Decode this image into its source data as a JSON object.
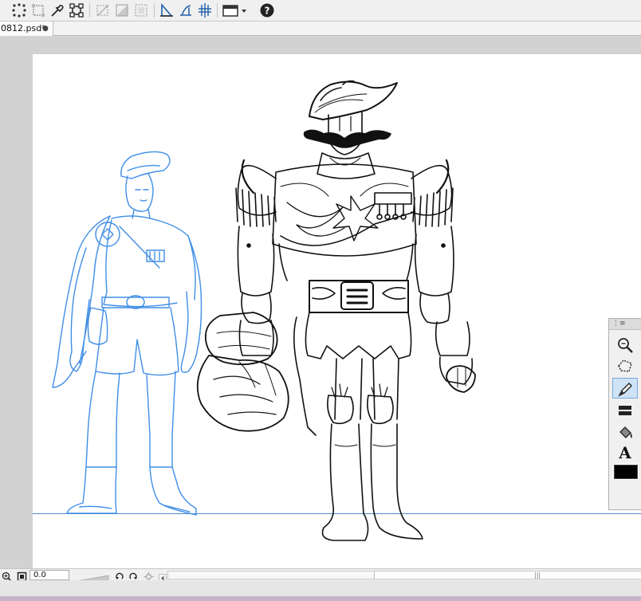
{
  "document": {
    "tab_label": "0812.psd*",
    "tab_close_glyph": "●"
  },
  "toolbar": {
    "icons": [
      "transform-points-icon",
      "crop-icon",
      "eyedropper-icon",
      "free-transform-icon",
      "deselect-icon",
      "fill-icon",
      "select-all-icon",
      "ruler-icon",
      "perspective-ruler-icon",
      "symmetry-ruler-icon",
      "view-options-icon",
      "help-icon"
    ]
  },
  "toolbox": {
    "grip_label": "⋮≡",
    "tools": [
      "zoom-tool-icon",
      "lasso-tool-icon",
      "pen-tool-icon",
      "layer-tool-icon",
      "fill-bucket-tool-icon",
      "text-tool-icon"
    ],
    "active_tool": "pen-tool-icon",
    "text_tool_glyph": "A",
    "current_color": "#000000"
  },
  "status": {
    "zoom_value": "0.0",
    "scroll_grip_glyph": "|||"
  },
  "colors": {
    "sketch_blue": "#3f8ee6",
    "ink_black": "#111111",
    "baseline_blue": "#4a88d0"
  }
}
